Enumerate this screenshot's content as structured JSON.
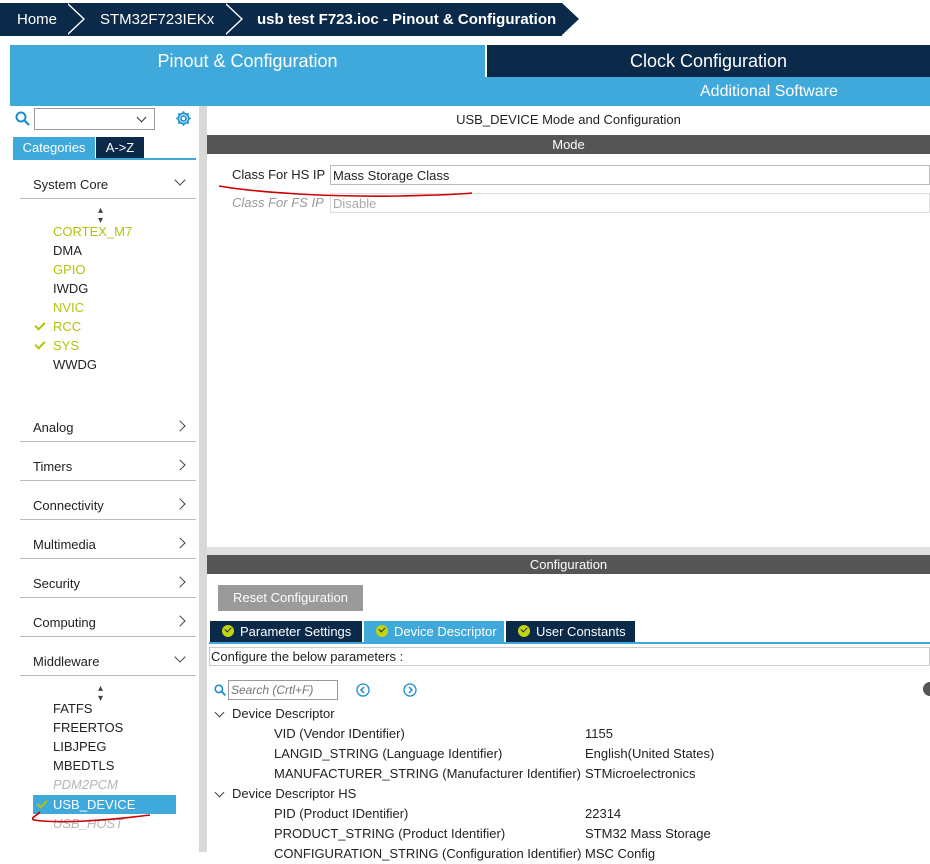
{
  "breadcrumb": {
    "home": "Home",
    "device": "STM32F723IEKx",
    "project": "usb test F723.ioc - Pinout & Configuration"
  },
  "tabs": {
    "pinout": "Pinout & Configuration",
    "clock": "Clock Configuration",
    "additional": "Additional Software"
  },
  "sidebar": {
    "search_value": "",
    "tab_categories": "Categories",
    "tab_az": "A->Z",
    "system_core": {
      "label": "System Core",
      "items": [
        {
          "label": "CORTEX_M7",
          "state": "warn"
        },
        {
          "label": "DMA",
          "state": "normal"
        },
        {
          "label": "GPIO",
          "state": "warn"
        },
        {
          "label": "IWDG",
          "state": "normal"
        },
        {
          "label": "NVIC",
          "state": "warn"
        },
        {
          "label": "RCC",
          "state": "checked"
        },
        {
          "label": "SYS",
          "state": "checked"
        },
        {
          "label": "WWDG",
          "state": "normal"
        }
      ]
    },
    "categories": [
      "Analog",
      "Timers",
      "Connectivity",
      "Multimedia",
      "Security",
      "Computing"
    ],
    "middleware": {
      "label": "Middleware",
      "items": [
        {
          "label": "FATFS",
          "state": "normal"
        },
        {
          "label": "FREERTOS",
          "state": "normal"
        },
        {
          "label": "LIBJPEG",
          "state": "normal"
        },
        {
          "label": "MBEDTLS",
          "state": "normal"
        },
        {
          "label": "PDM2PCM",
          "state": "disabled"
        },
        {
          "label": "USB_DEVICE",
          "state": "selected"
        },
        {
          "label": "USB_HOST",
          "state": "disabled"
        }
      ]
    }
  },
  "main": {
    "title": "USB_DEVICE Mode and Configuration",
    "mode_header": "Mode",
    "class_hs_label": "Class For HS IP",
    "class_hs_value": "Mass Storage Class",
    "class_fs_label": "Class For FS IP",
    "class_fs_value": "Disable",
    "config_header": "Configuration",
    "reset_button": "Reset Configuration",
    "subtabs": [
      "Parameter Settings",
      "Device Descriptor",
      "User Constants"
    ],
    "configure_text": "Configure the below parameters :",
    "search_placeholder": "Search (Crtl+F)",
    "tree": {
      "group1": "Device Descriptor",
      "group1_rows": [
        {
          "name": "VID (Vendor IDentifier)",
          "value": "1155"
        },
        {
          "name": "LANGID_STRING (Language Identifier)",
          "value": "English(United States)"
        },
        {
          "name": "MANUFACTURER_STRING (Manufacturer Identifier)",
          "value": "STMicroelectronics"
        }
      ],
      "group2": "Device Descriptor HS",
      "group2_rows": [
        {
          "name": "PID (Product IDentifier)",
          "value": "22314"
        },
        {
          "name": "PRODUCT_STRING (Product Identifier)",
          "value": "STM32 Mass Storage"
        },
        {
          "name": "CONFIGURATION_STRING (Configuration Identifier)",
          "value": "MSC Config"
        }
      ]
    }
  },
  "colors": {
    "navy": "#0b2a4a",
    "accent": "#3fa9dc",
    "warning": "#b5c20a",
    "annotation": "#cc0000"
  }
}
